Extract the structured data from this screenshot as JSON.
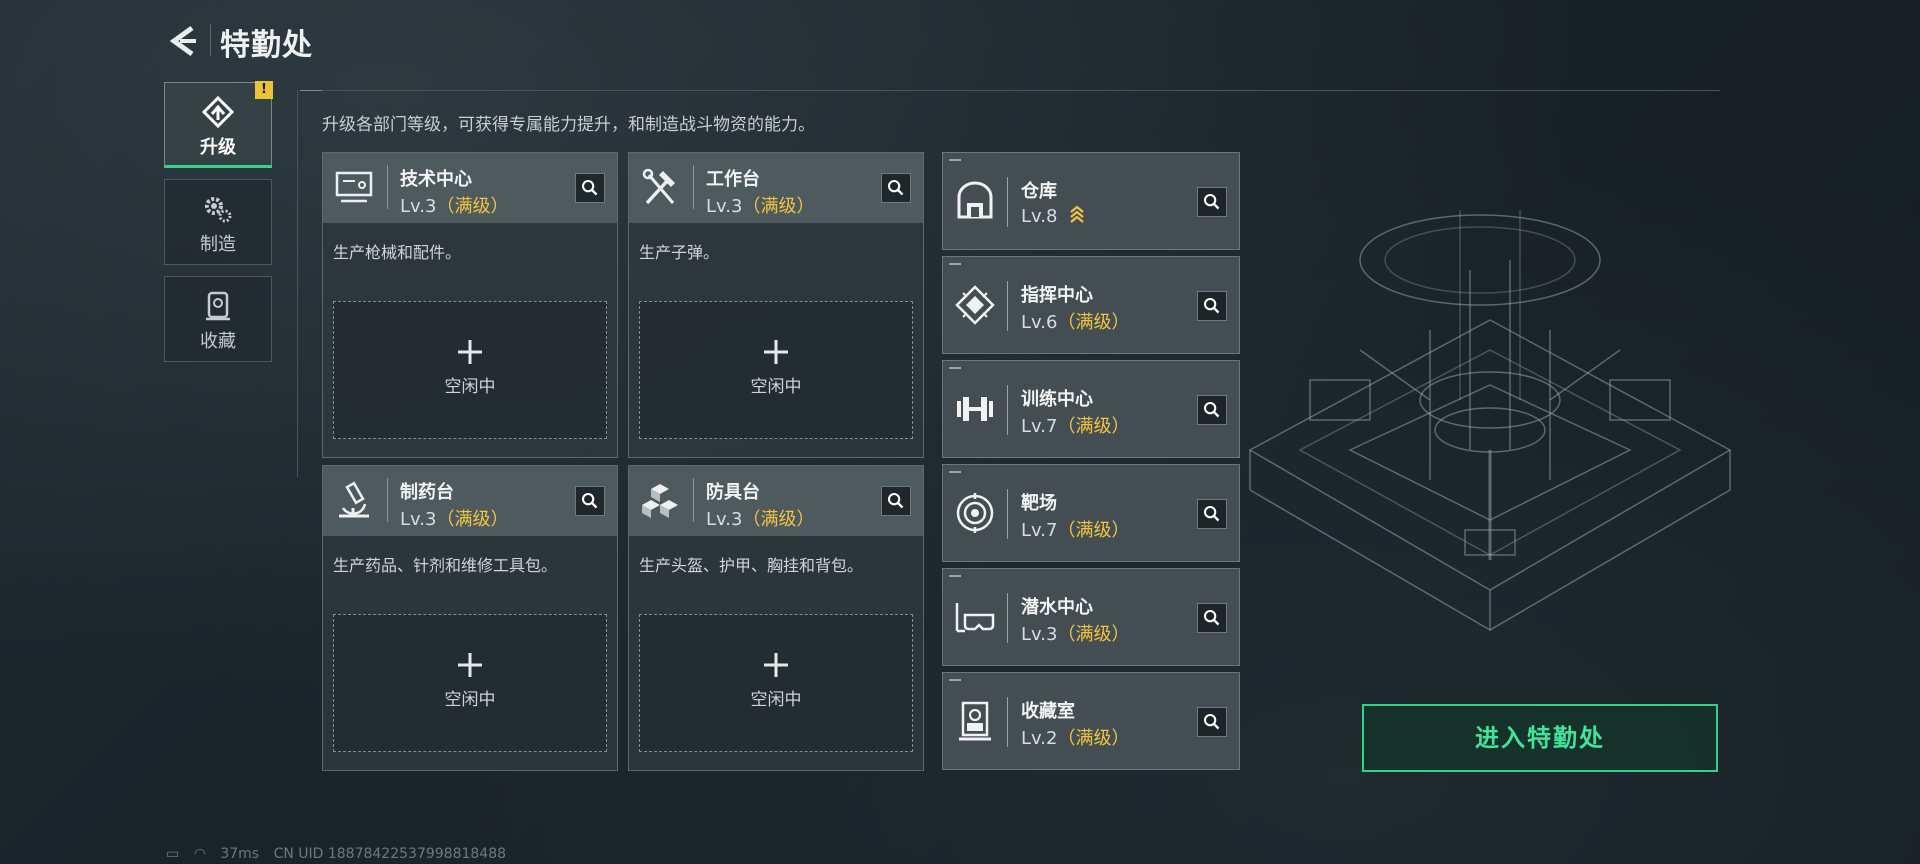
{
  "header": {
    "title": "特勤处"
  },
  "side_tabs": [
    {
      "label": "升级",
      "icon": "upgrade-icon",
      "active": true,
      "badge": "!"
    },
    {
      "label": "制造",
      "icon": "gears-icon",
      "active": false
    },
    {
      "label": "收藏",
      "icon": "collection-icon",
      "active": false
    }
  ],
  "intro": "升级各部门等级，可获得专属能力提升，和制造战斗物资的能力。",
  "production_cards": [
    {
      "name": "技术中心",
      "level": "Lv.3",
      "status": "（满级）",
      "desc": "生产枪械和配件。",
      "slot_label": "空闲中",
      "icon": "monitor-icon"
    },
    {
      "name": "工作台",
      "level": "Lv.3",
      "status": "（满级）",
      "desc": "生产子弹。",
      "slot_label": "空闲中",
      "icon": "tools-icon"
    },
    {
      "name": "制药台",
      "level": "Lv.3",
      "status": "（满级）",
      "desc": "生产药品、针剂和维修工具包。",
      "slot_label": "空闲中",
      "icon": "microscope-icon"
    },
    {
      "name": "防具台",
      "level": "Lv.3",
      "status": "（满级）",
      "desc": "生产头盔、护甲、胸挂和背包。",
      "slot_label": "空闲中",
      "icon": "cubes-icon"
    }
  ],
  "facilities": [
    {
      "name": "仓库",
      "level": "Lv.8",
      "status": "",
      "upgradeable": true,
      "icon": "warehouse-icon"
    },
    {
      "name": "指挥中心",
      "level": "Lv.6",
      "status": "（满级）",
      "icon": "chip-icon"
    },
    {
      "name": "训练中心",
      "level": "Lv.7",
      "status": "（满级）",
      "icon": "dumbbell-icon"
    },
    {
      "name": "靶场",
      "level": "Lv.7",
      "status": "（满级）",
      "icon": "target-icon"
    },
    {
      "name": "潜水中心",
      "level": "Lv.3",
      "status": "（满级）",
      "icon": "diving-mask-icon"
    },
    {
      "name": "收藏室",
      "level": "Lv.2",
      "status": "（满级）",
      "icon": "display-case-icon"
    }
  ],
  "enter_button": "进入特勤处",
  "status_bar": {
    "ping": "37ms",
    "uid": "CN UID 18878422537998818488"
  },
  "colors": {
    "accent_green": "#39d28f",
    "max_level_gold": "#f0c541",
    "badge_yellow": "#e9c33c"
  }
}
